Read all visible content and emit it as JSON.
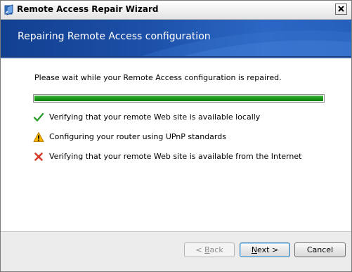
{
  "window": {
    "title": "Remote Access Repair Wizard",
    "icon": "wizard-app-icon"
  },
  "banner": {
    "heading": "Repairing Remote Access configuration"
  },
  "main": {
    "instruction": "Please wait while your Remote Access configuration is repaired.",
    "progress": {
      "fraction": 1.0,
      "color": "#1a9a1a"
    },
    "steps": [
      {
        "status": "success",
        "icon": "checkmark-icon",
        "text": "Verifying that your remote Web site is available locally"
      },
      {
        "status": "warning",
        "icon": "warning-icon",
        "text": "Configuring your router using UPnP standards"
      },
      {
        "status": "error",
        "icon": "error-x-icon",
        "text": "Verifying that your remote Web site is available from the Internet"
      }
    ]
  },
  "buttons": {
    "back": {
      "prefix": "< ",
      "hotkey": "B",
      "rest": "ack",
      "enabled": false
    },
    "next": {
      "hotkey": "N",
      "rest": "ext >",
      "enabled": true
    },
    "cancel": {
      "label": "Cancel",
      "enabled": true
    }
  },
  "colors": {
    "banner": "#1c4fa7",
    "success": "#2e9e2e",
    "warning": "#f0a000",
    "error": "#d63a2a"
  }
}
